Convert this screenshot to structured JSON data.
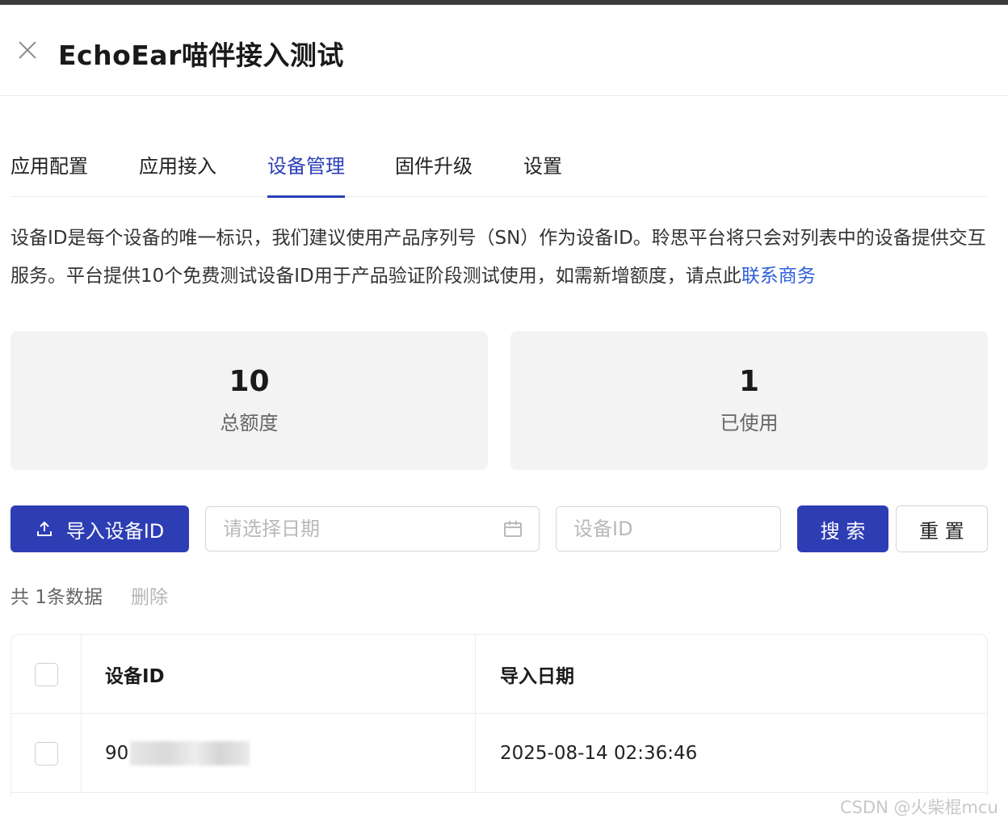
{
  "header": {
    "title": "EchoEar喵伴接入测试"
  },
  "tabs": [
    {
      "label": "应用配置",
      "active": false
    },
    {
      "label": "应用接入",
      "active": false
    },
    {
      "label": "设备管理",
      "active": true
    },
    {
      "label": "固件升级",
      "active": false
    },
    {
      "label": "设置",
      "active": false
    }
  ],
  "description": {
    "text": "设备ID是每个设备的唯一标识，我们建议使用产品序列号（SN）作为设备ID。聆思平台将只会对列表中的设备提供交互服务。平台提供10个免费测试设备ID用于产品验证阶段测试使用，如需新增额度，请点此",
    "link_text": "联系商务"
  },
  "stats": {
    "total": {
      "value": "10",
      "label": "总额度"
    },
    "used": {
      "value": "1",
      "label": "已使用"
    }
  },
  "toolbar": {
    "import_label": "导入设备ID",
    "date_placeholder": "请选择日期",
    "device_id_placeholder": "设备ID",
    "search_label": "搜 索",
    "reset_label": "重 置"
  },
  "summary": {
    "count_text": "共 1条数据",
    "delete_label": "删除"
  },
  "table": {
    "columns": [
      "设备ID",
      "导入日期"
    ],
    "rows": [
      {
        "device_id_visible": "90",
        "import_date": "2025-08-14 02:36:46"
      }
    ]
  },
  "watermark": "CSDN @火柴棍mcu",
  "colors": {
    "accent": "#2d3db4",
    "link": "#2e5fd9",
    "card_bg": "#f3f3f3"
  }
}
